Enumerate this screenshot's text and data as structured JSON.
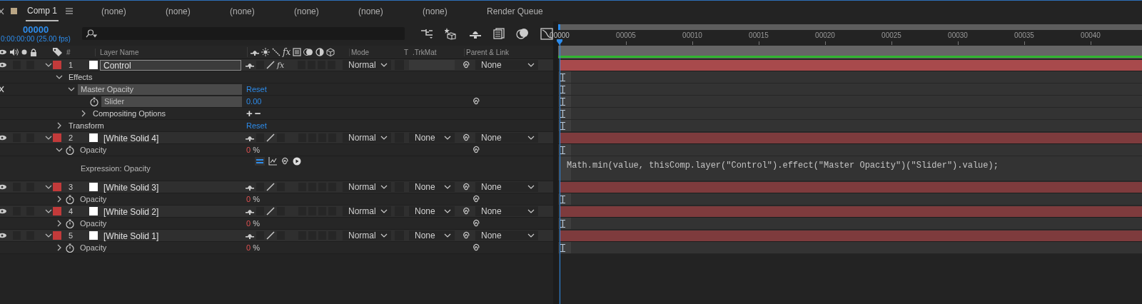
{
  "tabs": [
    {
      "label": "Comp 1",
      "kind": "composition",
      "selected": true
    },
    {
      "label": "(none)",
      "kind": "panel",
      "selected": false
    },
    {
      "label": "(none)",
      "kind": "panel",
      "selected": false
    },
    {
      "label": "(none)",
      "kind": "panel",
      "selected": false
    },
    {
      "label": "(none)",
      "kind": "panel",
      "selected": false
    },
    {
      "label": "(none)",
      "kind": "panel",
      "selected": false
    },
    {
      "label": "(none)",
      "kind": "panel",
      "selected": false
    },
    {
      "label": "Render Queue",
      "kind": "panel",
      "selected": false
    }
  ],
  "timecode": {
    "frame": "00000",
    "detail": "0:00:00:00 (25.00 fps)"
  },
  "columns": {
    "number": "#",
    "layer_name": "Layer Name",
    "fx": "fx",
    "mode": "Mode",
    "track_matte_t": "T",
    "track_matte": ".TrkMat",
    "parent": "Parent & Link"
  },
  "ruler": {
    "labels": [
      "00000",
      "00005",
      "00010",
      "00015",
      "00020",
      "00025",
      "00030",
      "00035",
      "00040"
    ]
  },
  "layers": [
    {
      "number": "1",
      "name": "Control",
      "selected": true,
      "expanded": true,
      "fx": "fx",
      "preserve_transparency": false,
      "mode": "Normal",
      "parent": "None",
      "properties": [
        {
          "kind": "group",
          "label": "Effects",
          "expanded": true,
          "selected": false,
          "children": [
            {
              "kind": "effect",
              "label": "Master Opacity",
              "expanded": true,
              "selected": true,
              "action": "Reset",
              "children": [
                {
                  "kind": "property",
                  "label": "Slider",
                  "stopwatch": true,
                  "selected": true,
                  "value": "0.00",
                  "driven": false,
                  "pickwhip": true
                },
                {
                  "kind": "group",
                  "label": "Compositing Options",
                  "expanded": false,
                  "selected": false,
                  "controls": [
                    "+",
                    "−"
                  ]
                }
              ]
            }
          ]
        },
        {
          "kind": "group",
          "label": "Transform",
          "expanded": false,
          "selected": false,
          "action": "Reset"
        }
      ]
    },
    {
      "number": "2",
      "name": "[White Solid 4]",
      "selected": false,
      "expanded": true,
      "preserve_transparency": false,
      "mode": "Normal",
      "trkmat": "None",
      "parent": "None",
      "properties": [
        {
          "kind": "property",
          "label": "Opacity",
          "stopwatch": true,
          "expanded": true,
          "selected": false,
          "value": "0",
          "unit": "%",
          "driven": true,
          "pickwhip": true,
          "children": [
            {
              "kind": "expression",
              "label": "Expression: Opacity",
              "selected": false,
              "code": "Math.min(value, thisComp.layer(\"Control\").effect(\"Master Opacity\")(\"Slider\").value);"
            }
          ]
        }
      ]
    },
    {
      "number": "3",
      "name": "[White Solid 3]",
      "selected": false,
      "expanded": true,
      "preserve_transparency": false,
      "mode": "Normal",
      "trkmat": "None",
      "parent": "None",
      "properties": [
        {
          "kind": "property",
          "label": "Opacity",
          "stopwatch": true,
          "expanded": false,
          "selected": false,
          "value": "0",
          "unit": "%",
          "driven": true,
          "pickwhip": true
        }
      ]
    },
    {
      "number": "4",
      "name": "[White Solid 2]",
      "selected": false,
      "expanded": true,
      "preserve_transparency": false,
      "mode": "Normal",
      "trkmat": "None",
      "parent": "None",
      "properties": [
        {
          "kind": "property",
          "label": "Opacity",
          "stopwatch": true,
          "expanded": false,
          "selected": false,
          "value": "0",
          "unit": "%",
          "driven": true,
          "pickwhip": true
        }
      ]
    },
    {
      "number": "5",
      "name": "[White Solid 1]",
      "selected": false,
      "expanded": true,
      "preserve_transparency": false,
      "mode": "Normal",
      "trkmat": "None",
      "parent": "None",
      "properties": [
        {
          "kind": "property",
          "label": "Opacity",
          "stopwatch": true,
          "expanded": false,
          "selected": false,
          "value": "0",
          "unit": "%",
          "driven": true,
          "pickwhip": true
        }
      ]
    }
  ]
}
